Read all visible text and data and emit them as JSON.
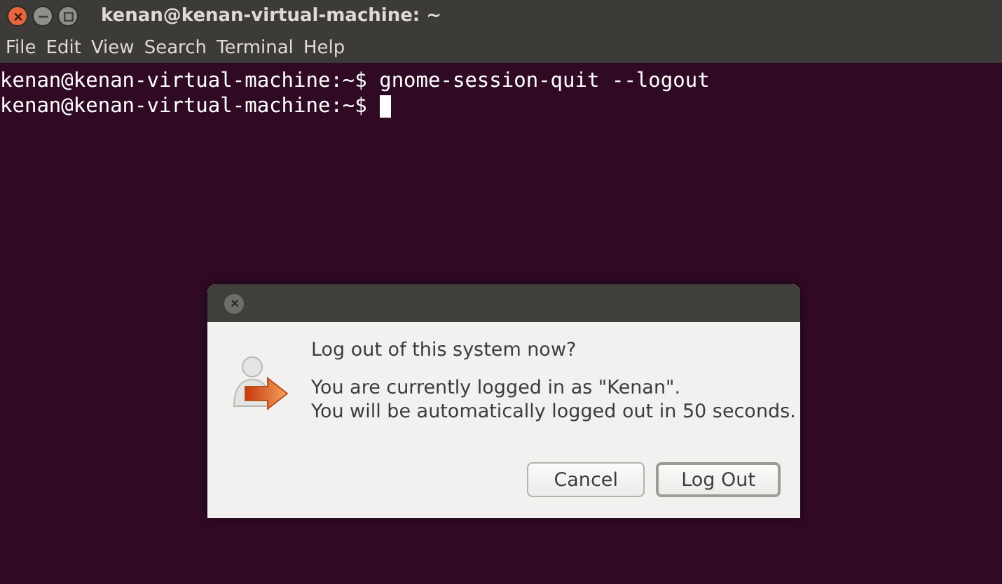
{
  "window": {
    "title": "kenan@kenan-virtual-machine: ~"
  },
  "menu": [
    "File",
    "Edit",
    "View",
    "Search",
    "Terminal",
    "Help"
  ],
  "terminal": {
    "lines": [
      {
        "prompt": "kenan@kenan-virtual-machine:~$",
        "command": "gnome-session-quit --logout",
        "cursor": false
      },
      {
        "prompt": "kenan@kenan-virtual-machine:~$",
        "cursor": true
      }
    ]
  },
  "dialog": {
    "heading": "Log out of this system now?",
    "message": [
      "You are currently logged in as \"Kenan\".",
      "You will be automatically logged out in 50 seconds."
    ],
    "buttons": [
      {
        "label": "Cancel",
        "default": false
      },
      {
        "label": "Log Out",
        "default": true
      }
    ]
  }
}
